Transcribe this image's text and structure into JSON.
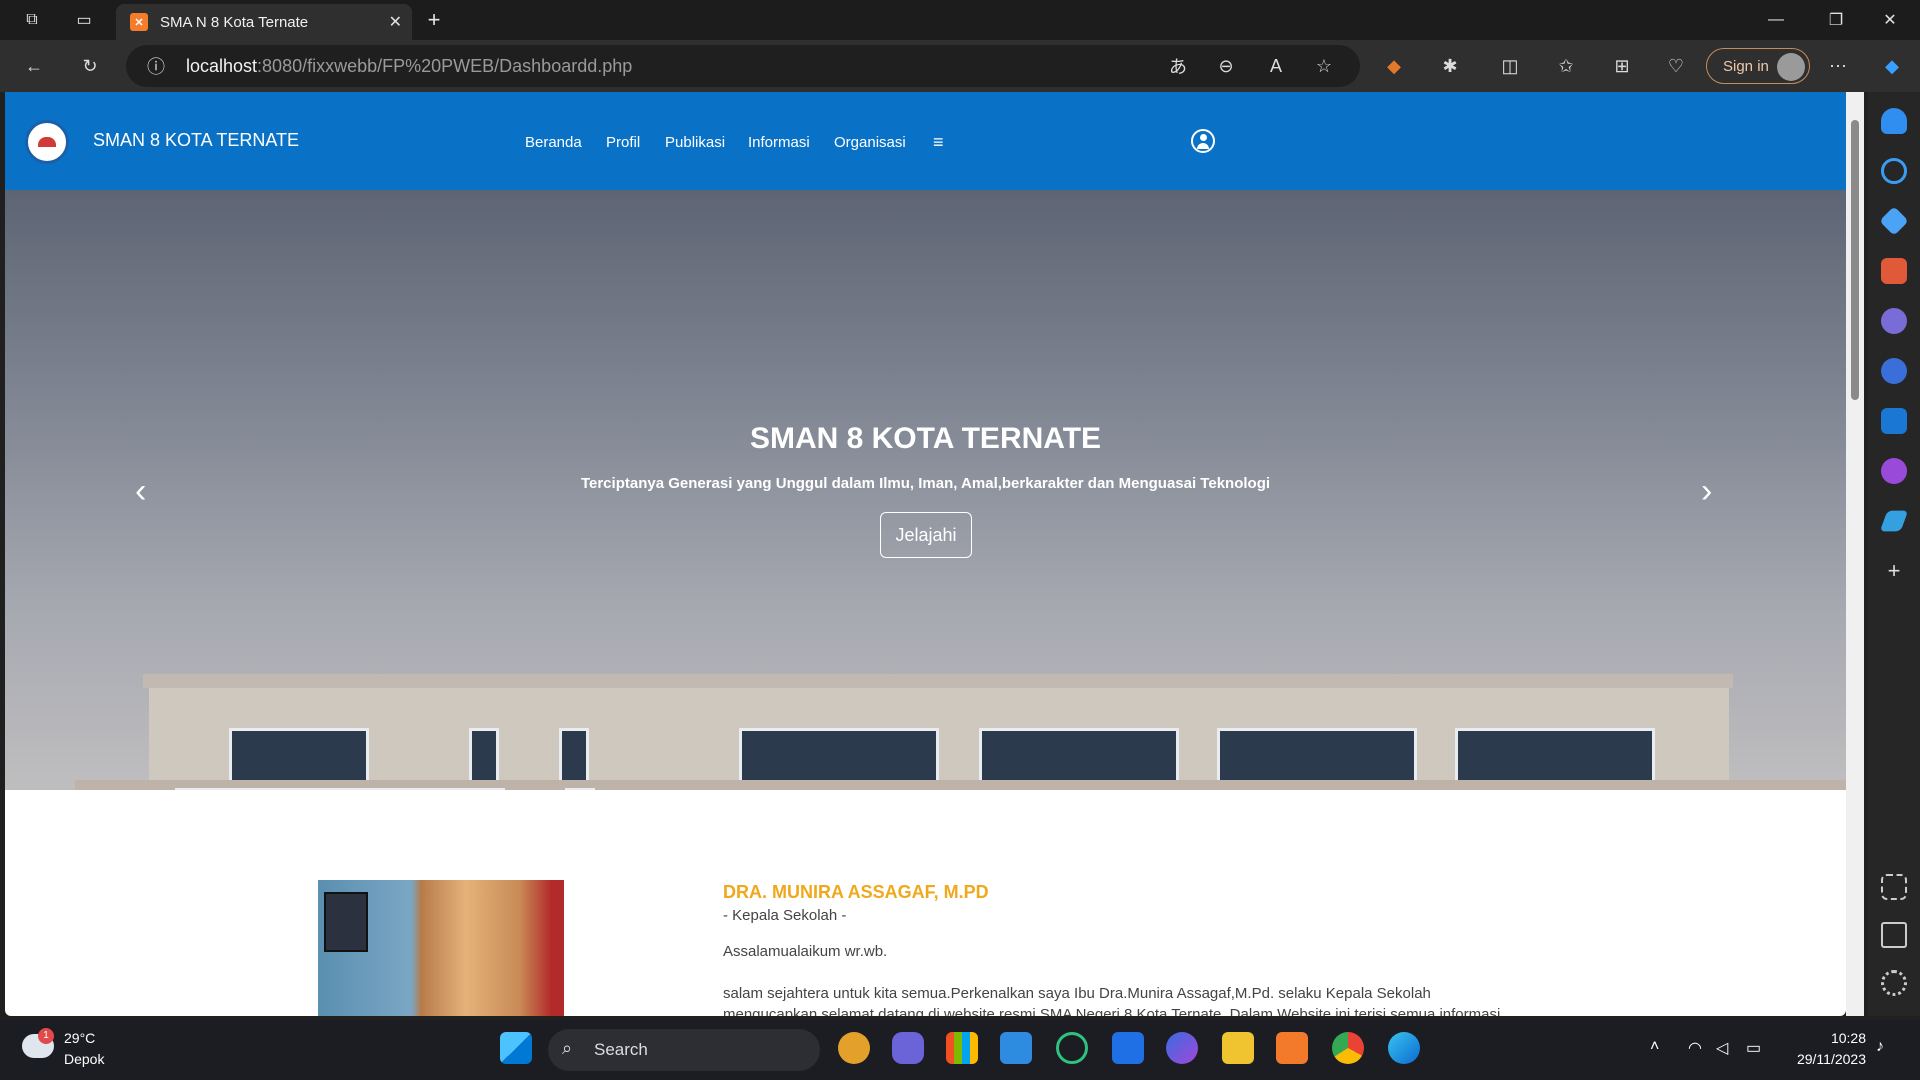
{
  "browser": {
    "tab_title": "SMA N 8 Kota Ternate",
    "tab_favicon": "xampp-icon",
    "url_host": "localhost",
    "url_rest": ":8080/fixxwebb/FP%20PWEB/Dashboardd.php",
    "signin_label": "Sign in"
  },
  "site": {
    "name": "SMAN 8 KOTA TERNATE",
    "menu": [
      "Beranda",
      "Profil",
      "Publikasi",
      "Informasi",
      "Organisasi"
    ],
    "menu_more_glyph": "≡",
    "brand_color": "#0a72c6"
  },
  "hero": {
    "title": "SMAN 8 KOTA TERNATE",
    "subtitle": "Terciptanya Generasi yang Unggul dalam Ilmu, Iman, Amal,berkarakter dan Menguasai Teknologi",
    "button": "Jelajahi",
    "prev_glyph": "‹",
    "next_glyph": "›",
    "slide_count": 3,
    "active_slide": 3
  },
  "principal": {
    "name": "DRA. MUNIRA ASSAGAF, M.PD",
    "role": "- Kepala Sekolah -",
    "greeting": "Assalamualaikum wr.wb.",
    "body": "salam sejahtera untuk kita semua.Perkenalkan saya Ibu Dra.Munira Assagaf,M.Pd. selaku Kepala Sekolah mengucapkan selamat datang di website resmi SMA Negeri 8 Kota Ternate. Dalam Website ini terisi semua informasi tentang kegiatan",
    "name_color": "#f0a81c"
  },
  "taskbar": {
    "weather_temp": "29°C",
    "weather_location": "Depok",
    "weather_badge": "1",
    "search_label": "Search",
    "time": "10:28",
    "date": "29/11/2023"
  }
}
